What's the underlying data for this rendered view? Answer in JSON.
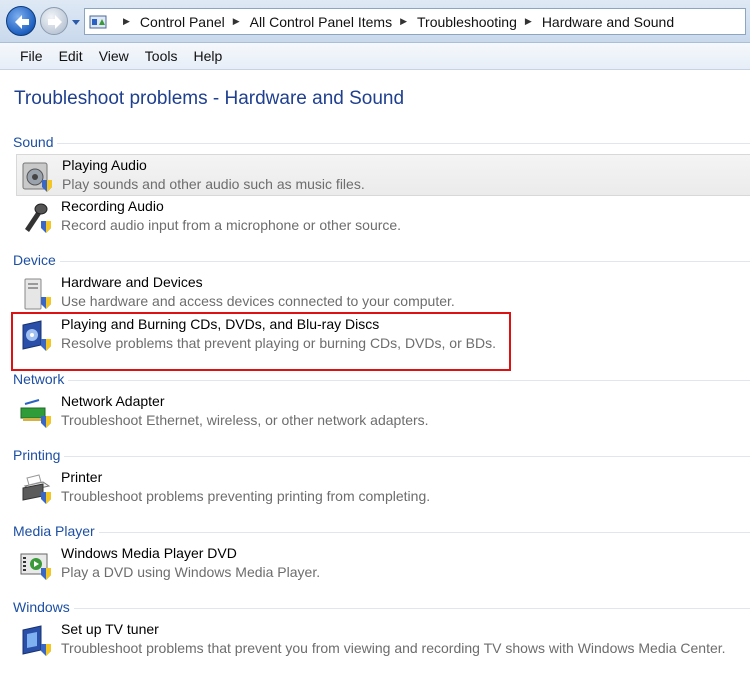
{
  "address_bar": {
    "breadcrumbs": [
      "Control Panel",
      "All Control Panel Items",
      "Troubleshooting",
      "Hardware and Sound"
    ]
  },
  "menu": [
    "File",
    "Edit",
    "View",
    "Tools",
    "Help"
  ],
  "page_title": "Troubleshoot problems - Hardware and Sound",
  "groups": [
    {
      "label": "Sound",
      "items": [
        {
          "title": "Playing Audio",
          "desc": "Play sounds and other audio such as music files.",
          "icon": "speaker-icon"
        },
        {
          "title": "Recording Audio",
          "desc": "Record audio input from a microphone or other source.",
          "icon": "microphone-icon"
        }
      ]
    },
    {
      "label": "Device",
      "items": [
        {
          "title": "Hardware and Devices",
          "desc": "Use hardware and access devices connected to your computer.",
          "icon": "computer-tower-icon"
        },
        {
          "title": "Playing and Burning CDs, DVDs, and Blu-ray Discs",
          "desc": "Resolve problems that prevent playing or burning CDs, DVDs, or BDs.",
          "icon": "disc-icon"
        }
      ]
    },
    {
      "label": "Network",
      "items": [
        {
          "title": "Network Adapter",
          "desc": "Troubleshoot Ethernet, wireless, or other network adapters.",
          "icon": "network-adapter-icon"
        }
      ]
    },
    {
      "label": "Printing",
      "items": [
        {
          "title": "Printer",
          "desc": "Troubleshoot problems preventing printing from completing.",
          "icon": "printer-icon"
        }
      ]
    },
    {
      "label": "Media Player",
      "items": [
        {
          "title": "Windows Media Player DVD",
          "desc": "Play a DVD using Windows Media Player.",
          "icon": "media-player-icon"
        }
      ]
    },
    {
      "label": "Windows",
      "items": [
        {
          "title": "Set up TV tuner",
          "desc": "Troubleshoot problems that prevent you from viewing and recording TV shows with Windows Media Center.",
          "icon": "tv-tuner-icon"
        }
      ]
    }
  ],
  "colors": {
    "title": "#1f3f8f",
    "group_label": "#1d4fa3",
    "highlight_box": "#dd1111"
  }
}
